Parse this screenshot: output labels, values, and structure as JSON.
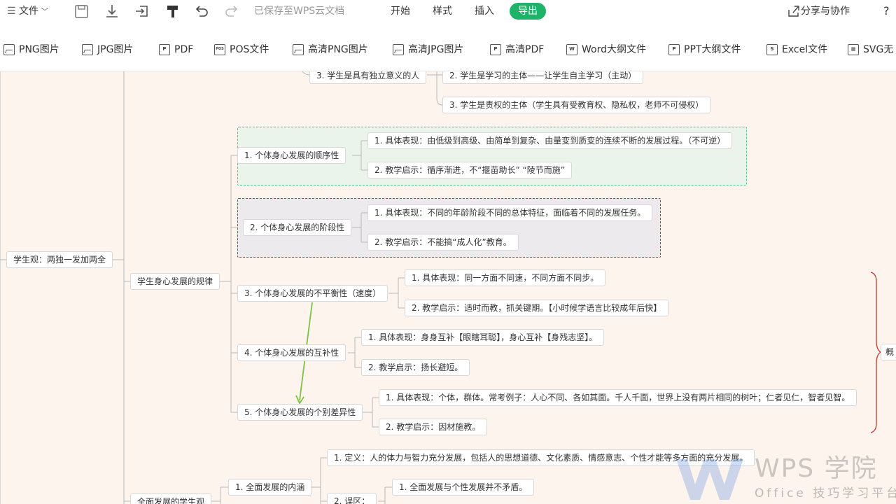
{
  "topbar": {
    "file_menu": "文件",
    "save_status": "已保存至WPS云文档",
    "menu": [
      "开始",
      "样式",
      "插入"
    ],
    "export": "导出",
    "share": "分享与协作",
    "help": "?"
  },
  "export_formats": [
    "PNG图片",
    "JPG图片",
    "PDF",
    "POS文件",
    "高清PNG图片",
    "高清JPG图片",
    "高清PDF",
    "Word大纲文件",
    "PPT大纲文件",
    "Excel文件",
    "SVG无"
  ],
  "mindmap": {
    "root_left": "学生观：两独一发加两全",
    "top_partial": {
      "parent": "3. 学生是具有独立意义的人",
      "children": [
        "2. 学生是学习的主体——让学生自主学习（主动）",
        "3. 学生是责权的主体（学生具有受教育权、隐私权，老师不可侵权）"
      ]
    },
    "branch": "学生身心发展的规律",
    "laws": [
      {
        "label": "1. 个体身心发展的顺序性",
        "children": [
          "1. 具体表现：由低级到高级、由简单到复杂、由量变到质变的连续不断的发展过程。（不可逆）",
          "2. 教学启示：循序渐进，不“揠苗助长” “陵节而施”"
        ]
      },
      {
        "label": "2. 个体身心发展的阶段性",
        "children": [
          "1. 具体表现：不同的年龄阶段不同的总体特征，面临着不同的发展任务。",
          "2. 教学启示：不能搞“成人化”教育。"
        ]
      },
      {
        "label": "3. 个体身心发展的不平衡性（速度）",
        "children": [
          "1. 具体表现：同一方面不同速，不同方面不同步。",
          "2. 教学启示：适时而教，抓关键期。【小时候学语言比较成年后快】"
        ]
      },
      {
        "label": "4. 个体身心发展的互补性",
        "children": [
          "1. 具体表现：身身互补【眼瞎耳聪】，身心互补【身残志坚】。",
          "2. 教学启示：扬长避短。"
        ]
      },
      {
        "label": "5. 个体身心发展的个别差异性",
        "children": [
          "1. 具体表现：个体，群体。常考例子：人心不同、各如其面。千人千面，世界上没有两片相同的树叶；仁者见仁，智者见智。",
          "2. 教学启示：因材施教。"
        ]
      }
    ],
    "summary_label": "概",
    "bottom": {
      "branch": "全面发展的学生观",
      "sub": "1. 全面发展的内涵",
      "definition": "1. 定义：人的体力与智力充分发展，包括人的思想道德、文化素质、情感意志、个性才能等多方面的充分发展。",
      "misconception": "2. 误区：",
      "mis_child": "1. 全面发展与个性发展并不矛盾。"
    }
  },
  "watermark": {
    "title": "WPS 学院",
    "subtitle": "Office 技巧学习平台"
  },
  "colors": {
    "canvas": "#fdf4ee",
    "export_green": "#1fb36a",
    "frame_green": "#4fc48a",
    "frame_red": "#d62a2a",
    "arrow_green": "#7cc142",
    "brace_red": "#c0392b"
  }
}
